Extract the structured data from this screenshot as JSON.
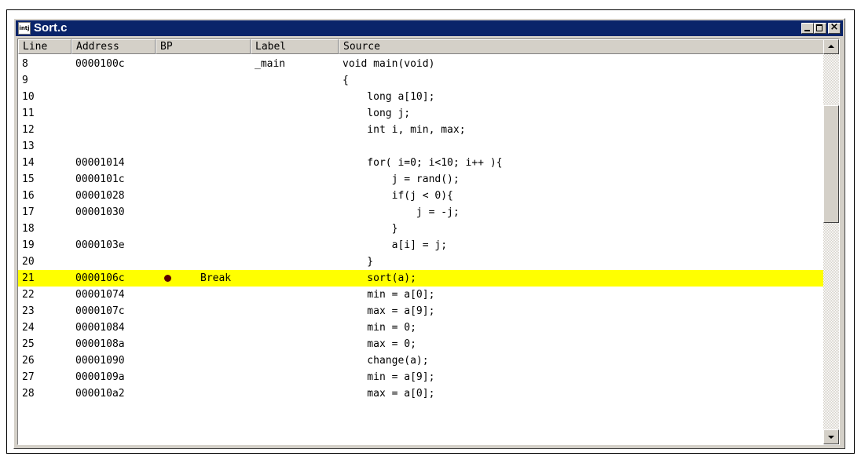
{
  "window": {
    "title": "Sort.c",
    "icon_label": "intj",
    "controls": {
      "minimize_icon": "minimize-icon",
      "maximize_icon": "maximize-icon",
      "close_glyph": "×"
    }
  },
  "columns": {
    "line": "Line",
    "address": "Address",
    "bp": "BP",
    "label": "Label",
    "source": "Source"
  },
  "colors": {
    "highlight": "#ffff00",
    "breakpoint": "#5a0000",
    "titlebar": "#0a246a"
  },
  "rows": [
    {
      "line": "8",
      "address": "0000100c",
      "bp": "",
      "label": "_main",
      "source": "void main(void)"
    },
    {
      "line": "9",
      "address": "",
      "bp": "",
      "label": "",
      "source": "{"
    },
    {
      "line": "10",
      "address": "",
      "bp": "",
      "label": "",
      "source": "    long a[10];"
    },
    {
      "line": "11",
      "address": "",
      "bp": "",
      "label": "",
      "source": "    long j;"
    },
    {
      "line": "12",
      "address": "",
      "bp": "",
      "label": "",
      "source": "    int i, min, max;"
    },
    {
      "line": "13",
      "address": "",
      "bp": "",
      "label": "",
      "source": ""
    },
    {
      "line": "14",
      "address": "00001014",
      "bp": "",
      "label": "",
      "source": "    for( i=0; i<10; i++ ){"
    },
    {
      "line": "15",
      "address": "0000101c",
      "bp": "",
      "label": "",
      "source": "        j = rand();"
    },
    {
      "line": "16",
      "address": "00001028",
      "bp": "",
      "label": "",
      "source": "        if(j < 0){"
    },
    {
      "line": "17",
      "address": "00001030",
      "bp": "",
      "label": "",
      "source": "            j = -j;"
    },
    {
      "line": "18",
      "address": "",
      "bp": "",
      "label": "",
      "source": "        }"
    },
    {
      "line": "19",
      "address": "0000103e",
      "bp": "",
      "label": "",
      "source": "        a[i] = j;"
    },
    {
      "line": "20",
      "address": "",
      "bp": "",
      "label": "",
      "source": "    }"
    },
    {
      "line": "21",
      "address": "0000106c",
      "bp": "Break",
      "label": "",
      "source": "    sort(a);"
    },
    {
      "line": "22",
      "address": "00001074",
      "bp": "",
      "label": "",
      "source": "    min = a[0];"
    },
    {
      "line": "23",
      "address": "0000107c",
      "bp": "",
      "label": "",
      "source": "    max = a[9];"
    },
    {
      "line": "24",
      "address": "00001084",
      "bp": "",
      "label": "",
      "source": "    min = 0;"
    },
    {
      "line": "25",
      "address": "0000108a",
      "bp": "",
      "label": "",
      "source": "    max = 0;"
    },
    {
      "line": "26",
      "address": "00001090",
      "bp": "",
      "label": "",
      "source": "    change(a);"
    },
    {
      "line": "27",
      "address": "0000109a",
      "bp": "",
      "label": "",
      "source": "    min = a[9];"
    },
    {
      "line": "28",
      "address": "000010a2",
      "bp": "",
      "label": "",
      "source": "    max = a[0];"
    }
  ],
  "current_line": "21"
}
